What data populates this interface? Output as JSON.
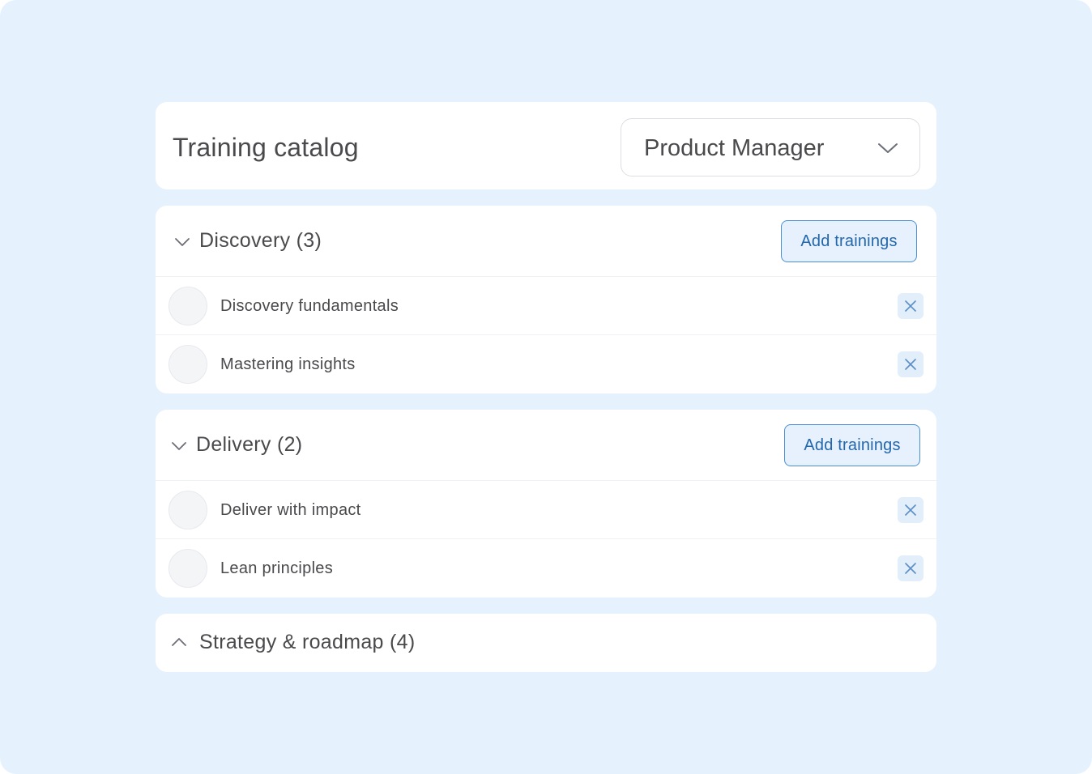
{
  "header": {
    "title": "Training catalog",
    "role_select": {
      "value": "Product Manager",
      "icon": "chevron-down-icon"
    }
  },
  "sections": [
    {
      "title": "Discovery (3)",
      "expanded": true,
      "add_label": "Add trainings",
      "items": [
        {
          "label": "Discovery fundamentals"
        },
        {
          "label": "Mastering insights"
        }
      ]
    },
    {
      "title": "Delivery (2)",
      "expanded": true,
      "add_label": "Add trainings",
      "items": [
        {
          "label": "Deliver with impact"
        },
        {
          "label": "Lean principles"
        }
      ]
    },
    {
      "title": "Strategy & roadmap (4)",
      "expanded": false
    }
  ],
  "colors": {
    "background": "#e5f1fd",
    "panel": "#ffffff",
    "text": "#4a4a4d",
    "accent": "#2367ad",
    "accent_border": "#4a8fd2",
    "accent_fill": "#e6f1fd"
  }
}
